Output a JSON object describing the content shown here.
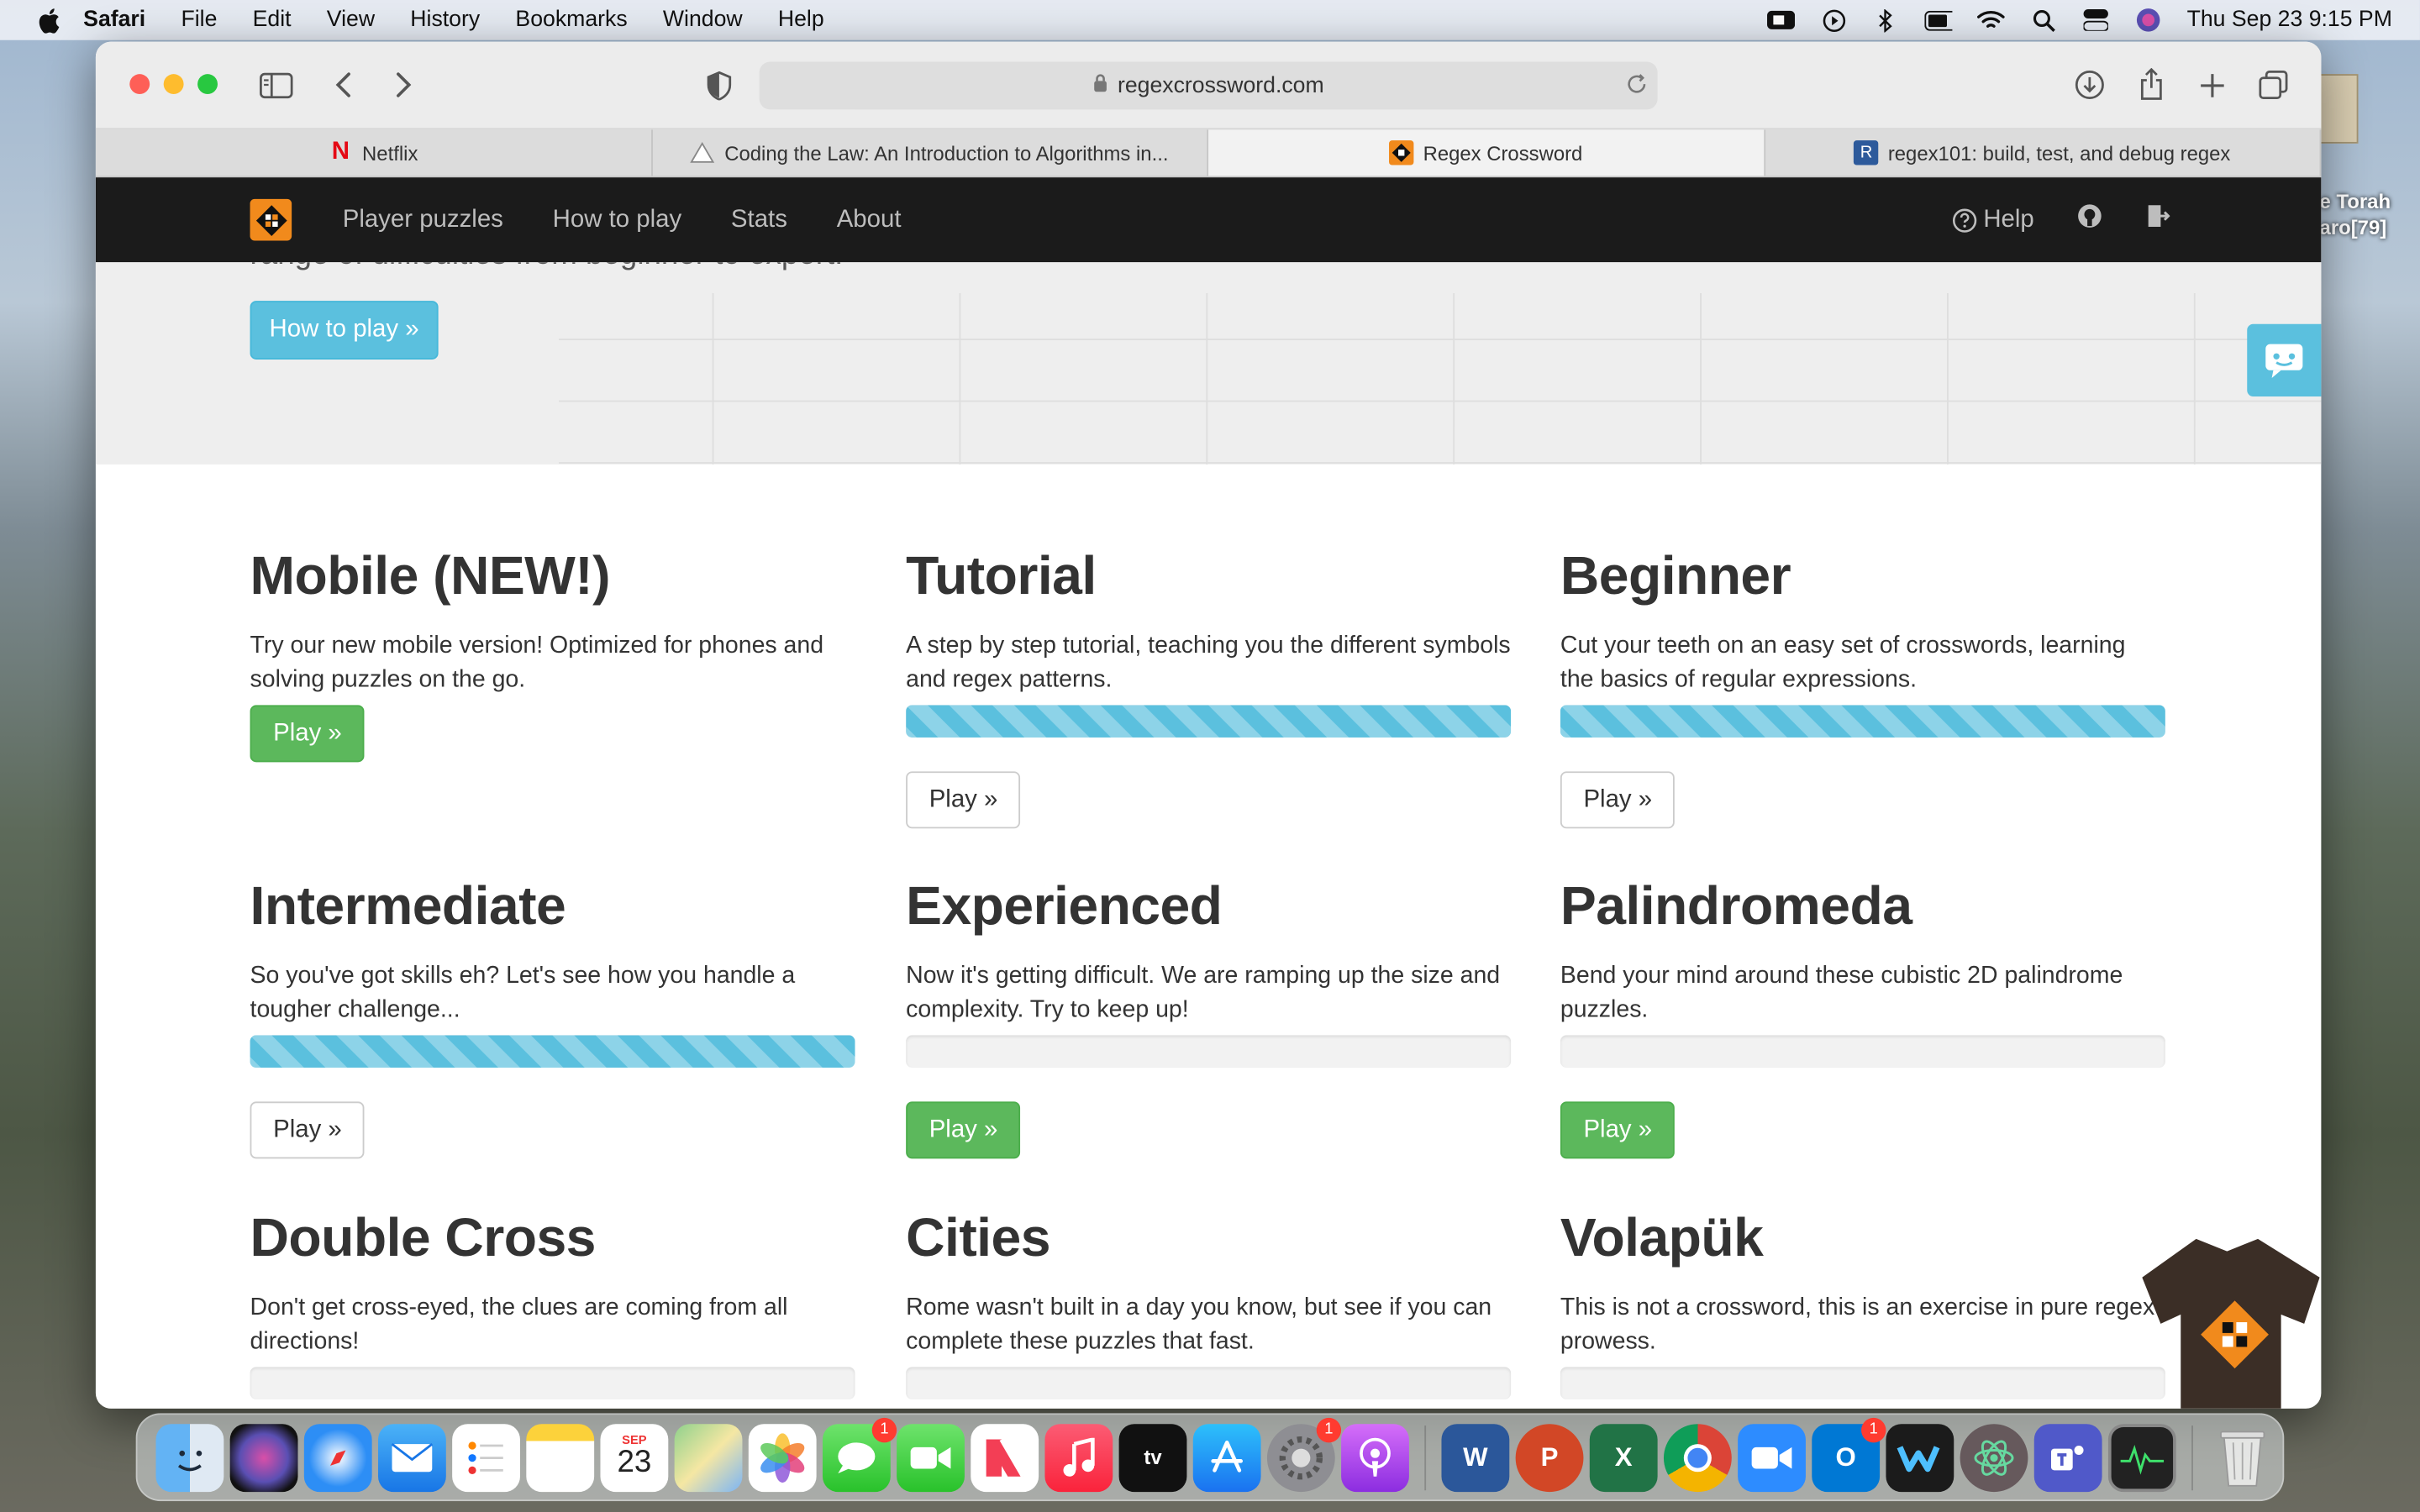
{
  "menubar": {
    "app": "Safari",
    "items": [
      "File",
      "Edit",
      "View",
      "History",
      "Bookmarks",
      "Window",
      "Help"
    ],
    "clock": "Thu Sep 23  9:15 PM"
  },
  "desktop": {
    "label_line1": "e Torah",
    "label_line2": "aro[79]"
  },
  "browser": {
    "url": "regexcrossword.com",
    "tabs": [
      {
        "label": "Netflix",
        "icon": "netflix-icon"
      },
      {
        "label": "Coding the Law: An Introduction to Algorithms in...",
        "icon": "triangle-icon"
      },
      {
        "label": "Regex Crossword",
        "icon": "regex-crossword-icon"
      },
      {
        "label": "regex101: build, test, and debug regex",
        "icon": "regex101-icon",
        "glyph": "R"
      }
    ],
    "active_tab": 2
  },
  "site": {
    "nav": [
      "Player puzzles",
      "How to play",
      "Stats",
      "About"
    ],
    "help": "Help",
    "hero_cut_text": "range of difficulties from beginner to expert.",
    "hero_button": "How to play »"
  },
  "puzzles": [
    {
      "title": "Mobile (NEW!)",
      "desc": "Try our new mobile version! Optimized for phones and solving puzzles on the go.",
      "progress": null,
      "button": "Play »",
      "style": "green"
    },
    {
      "title": "Tutorial",
      "desc": "A step by step tutorial, teaching you the different symbols and regex patterns.",
      "progress": 1,
      "button": "Play »",
      "style": "default"
    },
    {
      "title": "Beginner",
      "desc": "Cut your teeth on an easy set of crosswords, learning the basics of regular expressions.",
      "progress": 1,
      "button": "Play »",
      "style": "default"
    },
    {
      "title": "Intermediate",
      "desc": "So you've got skills eh? Let's see how you handle a tougher challenge...",
      "progress": 1,
      "button": "Play »",
      "style": "default"
    },
    {
      "title": "Experienced",
      "desc": "Now it's getting difficult. We are ramping up the size and complexity. Try to keep up!",
      "progress": 0,
      "button": "Play »",
      "style": "green"
    },
    {
      "title": "Palindromeda",
      "desc": "Bend your mind around these cubistic 2D palindrome puzzles.",
      "progress": 0,
      "button": "Play »",
      "style": "green"
    },
    {
      "title": "Double Cross",
      "desc": "Don't get cross-eyed, the clues are coming from all directions!",
      "progress": 0,
      "button": null,
      "style": "default"
    },
    {
      "title": "Cities",
      "desc": "Rome wasn't built in a day you know, but see if you can complete these puzzles that fast.",
      "progress": 0,
      "button": null,
      "style": "default"
    },
    {
      "title": "Volapük",
      "desc": "This is not a crossword, this is an exercise in pure regex prowess.",
      "progress": 0,
      "button": null,
      "style": "default"
    }
  ],
  "dock": {
    "calendar_month": "SEP",
    "calendar_day": "23",
    "tv_label": "tv",
    "badge": "1",
    "word": "W",
    "powerpoint": "P",
    "excel": "X",
    "outlook": "O"
  }
}
